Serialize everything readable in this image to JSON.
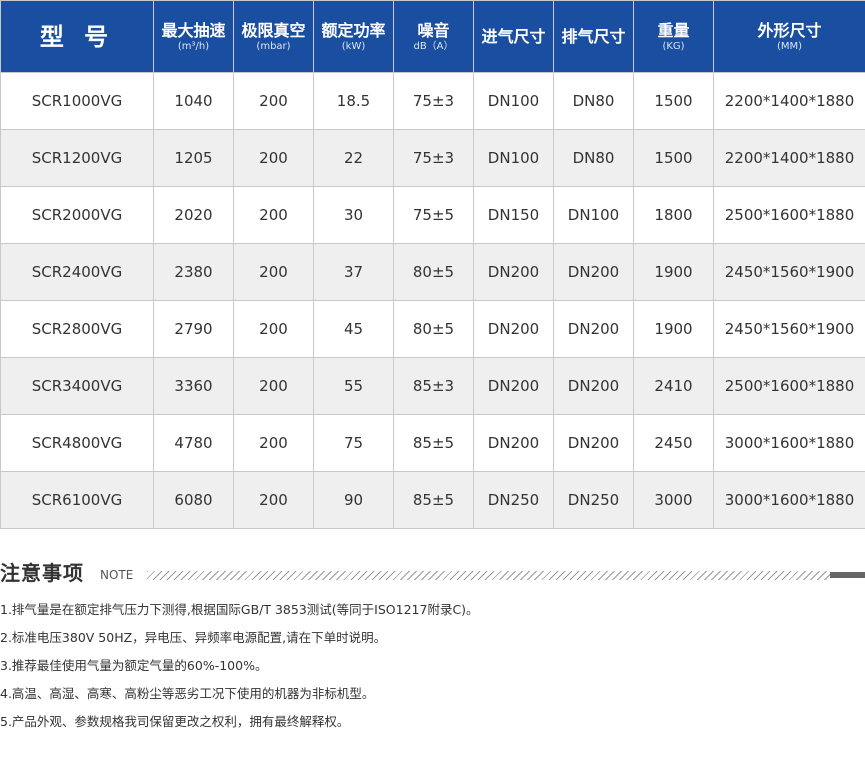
{
  "header": [
    {
      "main": "型 号",
      "unit": ""
    },
    {
      "main": "最大抽速",
      "unit": "(m³/h)"
    },
    {
      "main": "极限真空",
      "unit": "(mbar)"
    },
    {
      "main": "额定功率",
      "unit": "(kW)"
    },
    {
      "main": "噪音",
      "unit": "dB（A）"
    },
    {
      "main": "进气尺寸",
      "unit": ""
    },
    {
      "main": "排气尺寸",
      "unit": ""
    },
    {
      "main": "重量",
      "unit": "(KG)"
    },
    {
      "main": "外形尺寸",
      "unit": "(MM)"
    }
  ],
  "rows": [
    [
      "SCR1000VG",
      "1040",
      "200",
      "18.5",
      "75±3",
      "DN100",
      "DN80",
      "1500",
      "2200*1400*1880"
    ],
    [
      "SCR1200VG",
      "1205",
      "200",
      "22",
      "75±3",
      "DN100",
      "DN80",
      "1500",
      "2200*1400*1880"
    ],
    [
      "SCR2000VG",
      "2020",
      "200",
      "30",
      "75±5",
      "DN150",
      "DN100",
      "1800",
      "2500*1600*1880"
    ],
    [
      "SCR2400VG",
      "2380",
      "200",
      "37",
      "80±5",
      "DN200",
      "DN200",
      "1900",
      "2450*1560*1900"
    ],
    [
      "SCR2800VG",
      "2790",
      "200",
      "45",
      "80±5",
      "DN200",
      "DN200",
      "1900",
      "2450*1560*1900"
    ],
    [
      "SCR3400VG",
      "3360",
      "200",
      "55",
      "85±3",
      "DN200",
      "DN200",
      "2410",
      "2500*1600*1880"
    ],
    [
      "SCR4800VG",
      "4780",
      "200",
      "75",
      "85±5",
      "DN200",
      "DN200",
      "2450",
      "3000*1600*1880"
    ],
    [
      "SCR6100VG",
      "6080",
      "200",
      "90",
      "85±5",
      "DN250",
      "DN250",
      "3000",
      "3000*1600*1880"
    ]
  ],
  "notes": {
    "title": "注意事项",
    "subtitle": "NOTE",
    "items": [
      "1.排气量是在额定排气压力下测得,根据国际GB/T 3853测试(等同于ISO1217附录C)。",
      "2.标准电压380V 50HZ，异电压、异频率电源配置,请在下单时说明。",
      "3.推荐最佳使用气量为额定气量的60%-100%。",
      "4.高温、高湿、高寒、高粉尘等恶劣工况下使用的机器为非标机型。",
      "5.产品外观、参数规格我司保留更改之权利，拥有最终解释权。"
    ]
  },
  "colors": {
    "header_bg": "#1a4ea0",
    "row_alt_bg": "#efefef",
    "border": "#c8c8c8"
  }
}
